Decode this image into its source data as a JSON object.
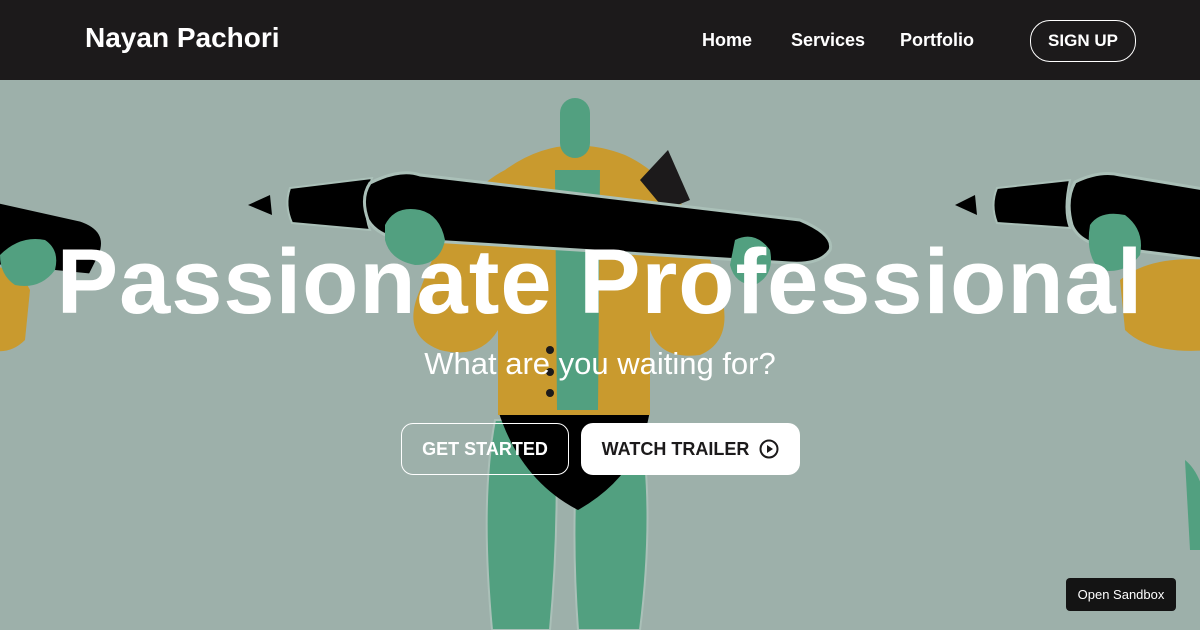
{
  "navbar": {
    "brand": "Nayan Pachori",
    "links": [
      "Home",
      "Services",
      "Portfolio"
    ],
    "signup_label": "SIGN UP"
  },
  "hero": {
    "title": "Passionate Professional",
    "subtitle": "What are you waiting for?",
    "get_started_label": "GET STARTED",
    "watch_trailer_label": "WATCH TRAILER",
    "play_icon": "play-circle-icon",
    "illustration": "figure-holding-pencil-illustration"
  },
  "sandbox_button_label": "Open Sandbox",
  "colors": {
    "navbar_bg": "#1c1a1b",
    "hero_bg": "#9db0aa",
    "figure_green": "#52a080",
    "jacket_mustard": "#c99a2e",
    "pencil_black": "#000000"
  }
}
